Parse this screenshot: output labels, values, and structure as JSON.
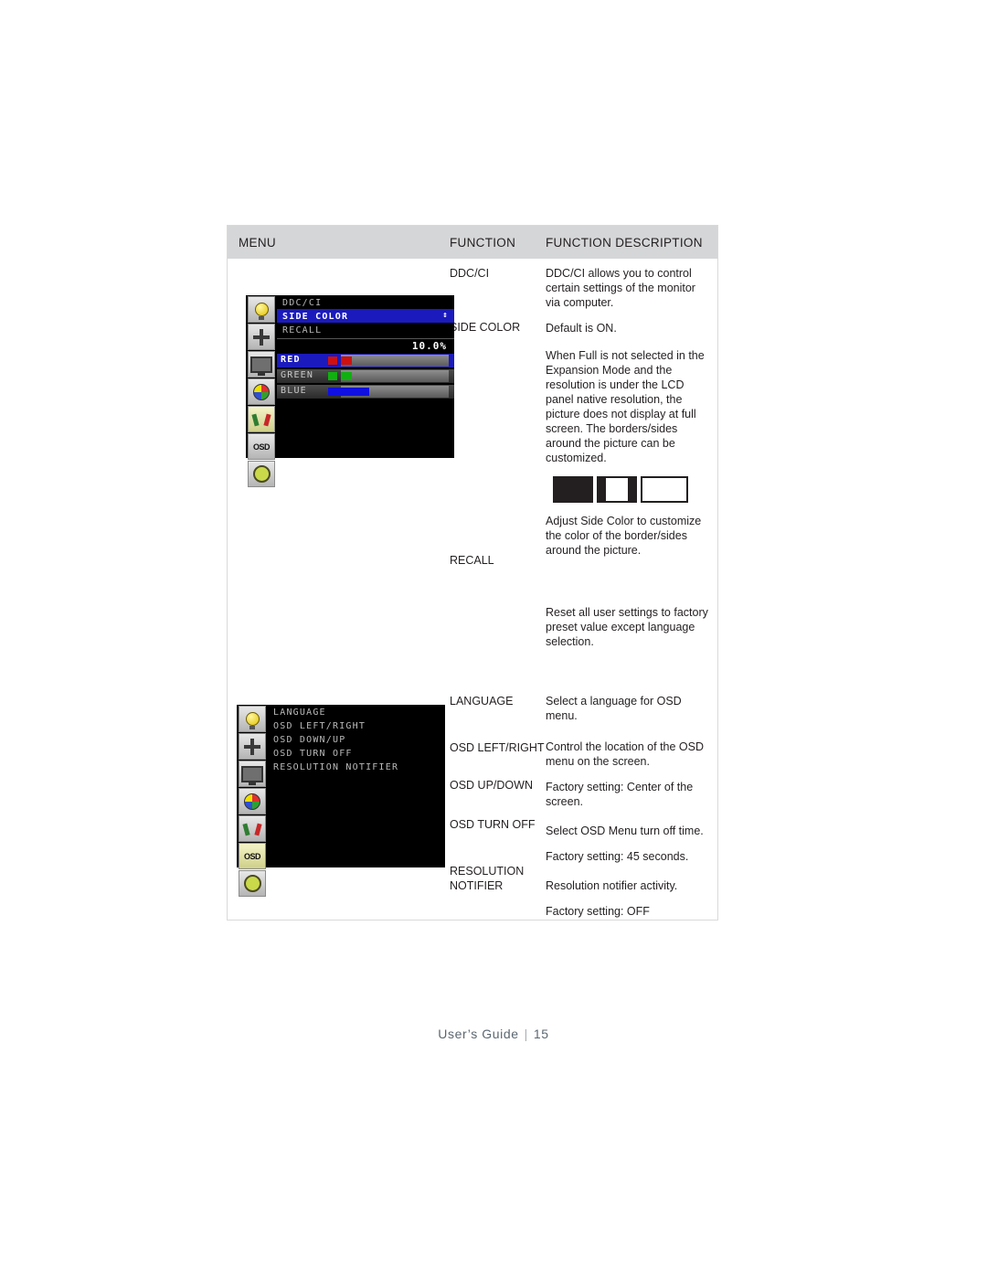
{
  "table": {
    "headers": {
      "menu": "MENU",
      "function": "FUNCTION",
      "description": "FUNCTION DESCRIPTION"
    }
  },
  "osd_panel_1": {
    "rows": [
      {
        "label": "DDC/CI",
        "highlighted": false
      },
      {
        "label": "SIDE COLOR",
        "highlighted": true,
        "arrows": "↕"
      },
      {
        "label": "RECALL",
        "highlighted": false
      }
    ],
    "value_readout": "10.0%",
    "color_rows": [
      {
        "label": "RED",
        "selected": true,
        "fill_percent": 10,
        "color": "#d01010"
      },
      {
        "label": "GREEN",
        "selected": false,
        "fill_percent": 10,
        "color": "#10b010"
      },
      {
        "label": "BLUE",
        "selected": false,
        "fill_percent": 38,
        "color": "#1010e0"
      }
    ],
    "icons": [
      "bulb-icon",
      "brightness-contrast-icon",
      "monitor-icon",
      "color-wheel-icon",
      "tools-icon",
      "osd-icon",
      "exit-power-icon"
    ]
  },
  "osd_panel_2": {
    "rows": [
      {
        "label": "LANGUAGE",
        "highlighted": false
      },
      {
        "label": "OSD LEFT/RIGHT",
        "highlighted": false
      },
      {
        "label": "OSD DOWN/UP",
        "highlighted": false
      },
      {
        "label": "OSD TURN OFF",
        "highlighted": false
      },
      {
        "label": "RESOLUTION NOTIFIER",
        "highlighted": false
      }
    ],
    "icons": [
      "bulb-icon",
      "brightness-contrast-icon",
      "monitor-icon",
      "color-wheel-icon",
      "tools-icon",
      "osd-icon",
      "exit-power-icon"
    ]
  },
  "rows": [
    {
      "function": "DDC/CI",
      "paragraphs": [
        "DDC/CI allows you to control certain settings of the monitor via computer.",
        "Default is ON."
      ]
    },
    {
      "function": "SIDE COLOR",
      "paragraphs": [
        "When Full is not selected in the Expansion Mode and the resolution is under the LCD panel native resolution, the picture does not display at full screen. The borders/sides around the picture can be customized."
      ],
      "illustration": "side-color-illustration",
      "paragraphs_after": [
        "Adjust Side Color to customize the color of the border/sides around the picture."
      ]
    },
    {
      "function": "RECALL",
      "paragraphs": [
        "Reset all user settings to factory preset value except language selection."
      ]
    },
    {
      "function": "LANGUAGE",
      "paragraphs": [
        "Select a language for OSD menu."
      ]
    },
    {
      "function": "OSD LEFT/RIGHT",
      "paragraphs": [
        "Control the location of the OSD menu on the screen."
      ]
    },
    {
      "function": "OSD UP/DOWN",
      "paragraphs": [
        "Factory setting: Center of the screen."
      ]
    },
    {
      "function": "OSD TURN OFF",
      "paragraphs": [
        "Select OSD Menu turn off time.",
        "Factory setting: 45 seconds."
      ]
    },
    {
      "function": "RESOLUTION NOTIFIER",
      "paragraphs": [
        "Resolution notifier activity.",
        "Factory setting: OFF"
      ]
    }
  ],
  "footer": {
    "label": "User’s Guide",
    "separator": "|",
    "page": "15"
  }
}
